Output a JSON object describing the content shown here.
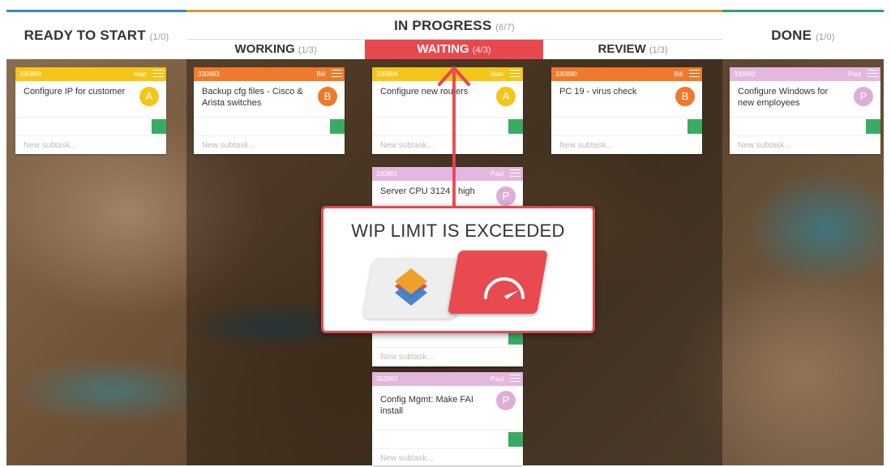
{
  "columns": {
    "ready": {
      "title": "READY TO START",
      "count": "(1/0)"
    },
    "in_progress": {
      "title": "IN PROGRESS",
      "count": "(6/7)"
    },
    "working": {
      "title": "WORKING",
      "count": "(1/3)"
    },
    "waiting": {
      "title": "WAITING",
      "count": "(4/3)"
    },
    "review": {
      "title": "REVIEW",
      "count": "(1/3)"
    },
    "done": {
      "title": "DONE",
      "count": "(1/0)"
    }
  },
  "cards": [
    {
      "id": "330889",
      "user": "Alan",
      "title": "Configure IP for customer",
      "avatar": "A",
      "color": "#f5c518",
      "avatar_color": "#f5c518",
      "new_subtask": "New subtask..."
    },
    {
      "id": "330883",
      "user": "Bill",
      "title": "Backup cfg files - Cisco & Arista switches",
      "avatar": "B",
      "color": "#ef7a2a",
      "avatar_color": "#ef7a2a",
      "new_subtask": "New subtask..."
    },
    {
      "id": "330884",
      "user": "Alan",
      "title": "Configure new routers",
      "avatar": "A",
      "color": "#f5c518",
      "avatar_color": "#f5c518",
      "new_subtask": "New subtask..."
    },
    {
      "id": "330880",
      "user": "Bill",
      "title": "PC 19 - virus check",
      "avatar": "B",
      "color": "#ef7a2a",
      "avatar_color": "#ef7a2a",
      "new_subtask": "New subtask..."
    },
    {
      "id": "330882",
      "user": "Paul",
      "title": "Configure Windows for new employees",
      "avatar": "P",
      "color": "#e4b7de",
      "avatar_color": "#dcaed8",
      "new_subtask": "New subtask..."
    },
    {
      "id": "330881",
      "user": "Paul",
      "title": "Server CPU 3124 - high",
      "avatar": "P",
      "color": "#e4b7de",
      "avatar_color": "#dcaed8",
      "new_subtask": "New subtask..."
    },
    {
      "id": "353992",
      "user": "Paul",
      "title": "Config Mgmt: Make FAI install",
      "avatar": "P",
      "color": "#e4b7de",
      "avatar_color": "#dcaed8",
      "new_subtask": "New subtask..."
    }
  ],
  "modal": {
    "title": "WIP LIMIT IS EXCEEDED"
  },
  "colors": {
    "alert": "#e8494f",
    "accent_green": "#3aab63"
  }
}
